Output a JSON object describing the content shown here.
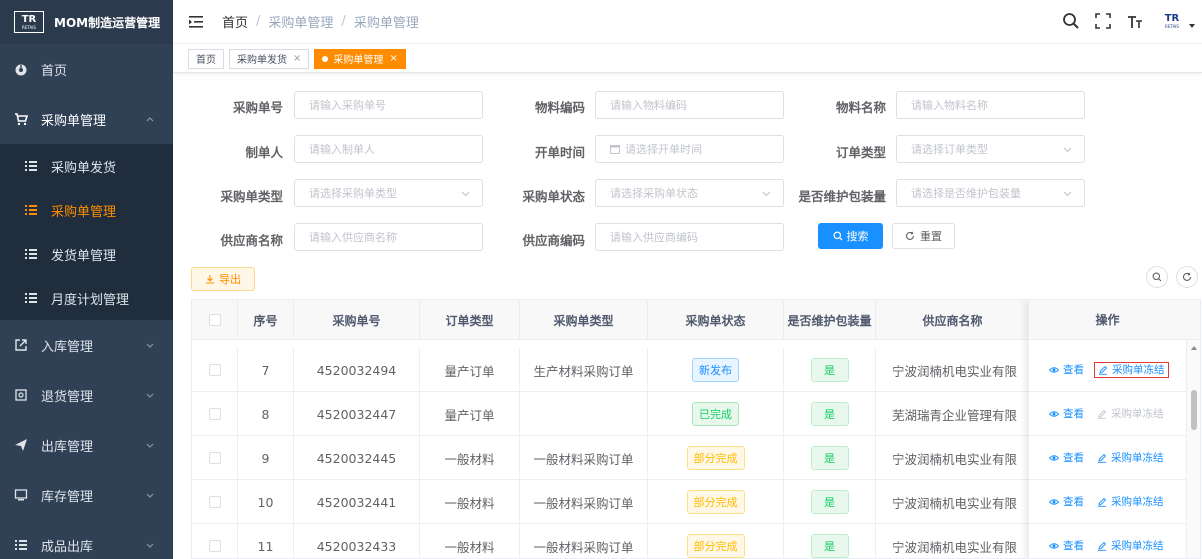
{
  "app": {
    "title": "MOM制造运营管理",
    "logo_top": "TR",
    "logo_bottom": "RETAIS"
  },
  "sidebar": {
    "home": "首页",
    "purchase": "采购单管理",
    "sub": [
      "采购单发货",
      "采购单管理",
      "发货单管理",
      "月度计划管理"
    ],
    "others": [
      "入库管理",
      "退货管理",
      "出库管理",
      "库存管理",
      "成品出库"
    ]
  },
  "breadcrumb": {
    "first": "首页",
    "second": "采购单管理",
    "third": "采购单管理"
  },
  "tags": {
    "t1": "首页",
    "t2": "采购单发货",
    "t3": "采购单管理"
  },
  "form": {
    "labels": {
      "po_no": "采购单号",
      "mat_code": "物料编码",
      "mat_name": "物料名称",
      "creator": "制单人",
      "open_time": "开单时间",
      "order_type": "订单类型",
      "po_type": "采购单类型",
      "po_status": "采购单状态",
      "maintain": "是否维护包装量",
      "supplier_name": "供应商名称",
      "supplier_code": "供应商编码"
    },
    "placeholders": {
      "po_no": "请输入采购单号",
      "mat_code": "请输入物料编码",
      "mat_name": "请输入物料名称",
      "creator": "请输入制单人",
      "open_time": "请选择开单时间",
      "order_type": "请选择订单类型",
      "po_type": "请选择采购单类型",
      "po_status": "请选择采购单状态",
      "maintain": "请选择是否维护包装量",
      "supplier_name": "请输入供应商名称",
      "supplier_code": "请输入供应商编码"
    },
    "search": "搜索",
    "reset": "重置",
    "export": "导出"
  },
  "table": {
    "headers": [
      "序号",
      "采购单号",
      "订单类型",
      "采购单类型",
      "采购单状态",
      "是否维护包装量",
      "供应商名称",
      "操作"
    ],
    "rows": [
      {
        "idx": "7",
        "po": "4520032494",
        "order_type": "量产订单",
        "po_type": "生产材料采购订单",
        "status": "新发布",
        "maintain": "是",
        "supplier": "宁波润楠机电实业有限",
        "view": "查看",
        "freeze": "采购单冻结"
      },
      {
        "idx": "8",
        "po": "4520032447",
        "order_type": "量产订单",
        "po_type": "",
        "status": "已完成",
        "maintain": "是",
        "supplier": "芜湖瑞青企业管理有限",
        "view": "查看",
        "freeze": "采购单冻结"
      },
      {
        "idx": "9",
        "po": "4520032445",
        "order_type": "一般材料",
        "po_type": "一般材料采购订单",
        "status": "部分完成",
        "maintain": "是",
        "supplier": "宁波润楠机电实业有限",
        "view": "查看",
        "freeze": "采购单冻结"
      },
      {
        "idx": "10",
        "po": "4520032441",
        "order_type": "一般材料",
        "po_type": "一般材料采购订单",
        "status": "部分完成",
        "maintain": "是",
        "supplier": "宁波润楠机电实业有限",
        "view": "查看",
        "freeze": "采购单冻结"
      },
      {
        "idx": "11",
        "po": "4520032433",
        "order_type": "一般材料",
        "po_type": "一般材料采购订单",
        "status": "部分完成",
        "maintain": "是",
        "supplier": "宁波润楠机电实业有限",
        "view": "查看",
        "freeze": "采购单冻结"
      }
    ]
  },
  "colors": {
    "accent": "#ff8c00",
    "primary": "#1890ff",
    "sidebar_bg": "#304156",
    "highlight_box": "#e53935"
  }
}
